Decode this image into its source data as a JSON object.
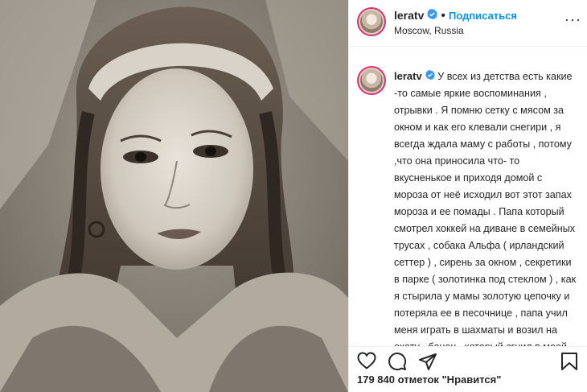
{
  "header": {
    "username": "leratv",
    "dot": "•",
    "follow_label": "Подписаться",
    "location": "Moscow, Russia",
    "more": "···"
  },
  "caption": {
    "username": "leratv",
    "text": "У всех из детства есть какие -то самые яркие воспоминания , отрывки . Я помню сетку с мясом за окном и как его клевали снегири , я всегда ждала маму с работы , потому ,что она приносила что- то вкусненькое и приходя домой с мороза от неё исходил вот этот запах мороза и ее помады . Папа который смотрел хоккей на диване в семейных трусах , собака Альфа ( ирландский сеттер ) , сирень за окном , секретики в парке ( золотинка под стеклом ) , как я стырила у мамы золотую цепочку и потеряла ее в песочнице , папа учил меня играть в шахматы и возил на охоту , банан , который сгнил в моей детской сумочке , когда я его решила спрятать и забыла про него"
  },
  "actions": {
    "icons": [
      "heart-icon",
      "comment-icon",
      "share-icon",
      "bookmark-icon"
    ]
  },
  "likes": {
    "text": "179 840 отметок \"Нравится\""
  },
  "colors": {
    "follow": "#0095f6",
    "verified": "#3897f0",
    "text": "#262626"
  }
}
